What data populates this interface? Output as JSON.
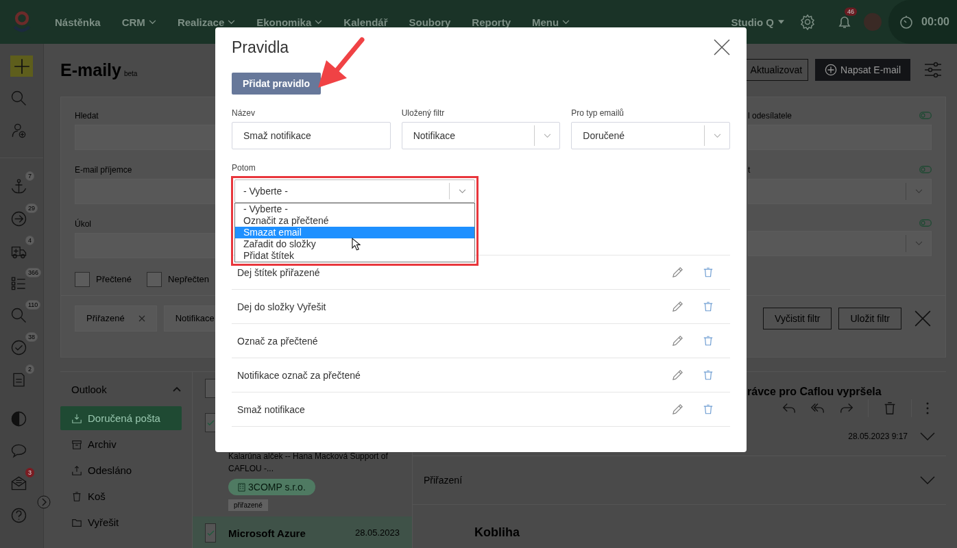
{
  "topbar": {
    "nav": [
      {
        "label": "Nástěnka",
        "dropdown": false
      },
      {
        "label": "CRM",
        "dropdown": true
      },
      {
        "label": "Realizace",
        "dropdown": true
      },
      {
        "label": "Ekonomika",
        "dropdown": true
      },
      {
        "label": "Kalendář",
        "dropdown": false
      },
      {
        "label": "Soubory",
        "dropdown": false
      },
      {
        "label": "Reporty",
        "dropdown": false
      },
      {
        "label": "Menu",
        "dropdown": true
      }
    ],
    "workspace": "Studio Q",
    "notifications": "46",
    "timer": "00:00"
  },
  "rail": [
    {
      "kind": "add",
      "alert": false
    },
    {
      "kind": "search",
      "alert": false
    },
    {
      "kind": "add-user",
      "alert": false
    },
    {
      "kind": "anchor",
      "badge": "7",
      "alert": false
    },
    {
      "kind": "arrow",
      "badge": "29",
      "alert": false
    },
    {
      "kind": "ambulance",
      "badge": "4",
      "alert": false
    },
    {
      "kind": "checklist",
      "badge": "366",
      "alert": false
    },
    {
      "kind": "search",
      "badge": "110",
      "alert": false
    },
    {
      "kind": "check",
      "badge": "38",
      "alert": false
    },
    {
      "kind": "clipboard",
      "badge": "2",
      "alert": false
    },
    {
      "kind": "contrast",
      "alert": false
    },
    {
      "kind": "chat",
      "alert": false
    },
    {
      "kind": "mail",
      "badge": "3",
      "alert": true
    },
    {
      "kind": "help",
      "alert": false
    }
  ],
  "page": {
    "title": "E-maily",
    "tag": "beta",
    "refresh_button": "Aktualizovat",
    "compose_button": "Napsat E-mail"
  },
  "filters": {
    "left_fields": [
      {
        "label": "Hledat"
      },
      {
        "label": "E-mail příjemce"
      },
      {
        "label": "Úkol"
      }
    ],
    "checkboxes": [
      {
        "label": "Přečtené",
        "checked": false
      },
      {
        "label": "Nepřečten",
        "checked": false
      }
    ],
    "right_fields": [
      {
        "label": "l odesílatele",
        "kind": "input",
        "enabled": false
      },
      {
        "label": "t",
        "kind": "select",
        "enabled": false
      },
      {
        "kind": "select",
        "enabled": false
      }
    ],
    "chips": [
      {
        "label": "Přiřazené",
        "removable": true
      },
      {
        "label": "Notifikace",
        "removable": false
      }
    ],
    "buttons": [
      "Vyčistit filtr",
      "Uložit filtr"
    ]
  },
  "folders": {
    "account": "Outlook",
    "expanded": true,
    "items": [
      {
        "label": "Doručená pošta",
        "kind": "inbox",
        "selected": true
      },
      {
        "label": "Archiv",
        "kind": "archive",
        "selected": false
      },
      {
        "label": "Odesláno",
        "kind": "sent",
        "selected": false
      },
      {
        "label": "Koš",
        "kind": "trash",
        "selected": false
      },
      {
        "label": "Vyřešit",
        "kind": "folder",
        "selected": false
      }
    ]
  },
  "messages": {
    "select_all_checked": false,
    "items": [
      {
        "checked": true,
        "selected": false,
        "preview": "Kalarúna alček -- Hana Macková Support of CAFLOU -...",
        "company": "3COMP s.r.o.",
        "tag": "přiřazené"
      },
      {
        "checked": true,
        "selected": true,
        "sender": "Microsoft Azure",
        "date": "28.05.2023"
      }
    ]
  },
  "detail": {
    "subject": "rávce pro Caflou vypršela",
    "date": "28.05.2023 9:17",
    "section": "Přiřazení",
    "body_heading": "Kobliha"
  },
  "modal": {
    "title": "Pravidla",
    "add_button": "Přidat pravidlo",
    "fields": [
      {
        "label": "Název",
        "kind": "input",
        "value": "Smaž notifikace"
      },
      {
        "label": "Uložený filtr",
        "kind": "select",
        "value": "Notifikace"
      },
      {
        "label": "Pro typ emailů",
        "kind": "select",
        "value": "Doručené"
      }
    ],
    "then": {
      "label": "Potom",
      "value": "- Vyberte -",
      "expanded": true,
      "options": [
        {
          "label": "- Vyberte -",
          "highlighted": false
        },
        {
          "label": "Označit za přečtené",
          "highlighted": false
        },
        {
          "label": "Smazat email",
          "highlighted": true
        },
        {
          "label": "Zařadit do složky",
          "highlighted": false
        },
        {
          "label": "Přidat štítek",
          "highlighted": false
        }
      ]
    },
    "rules": [
      {
        "name": "Dej štítek přiřazené"
      },
      {
        "name": "Dej do složky Vyřešit"
      },
      {
        "name": "Označ za přečtené"
      },
      {
        "name": "Notifikace označ za přečtené"
      },
      {
        "name": "Smaž notifikace"
      }
    ]
  }
}
